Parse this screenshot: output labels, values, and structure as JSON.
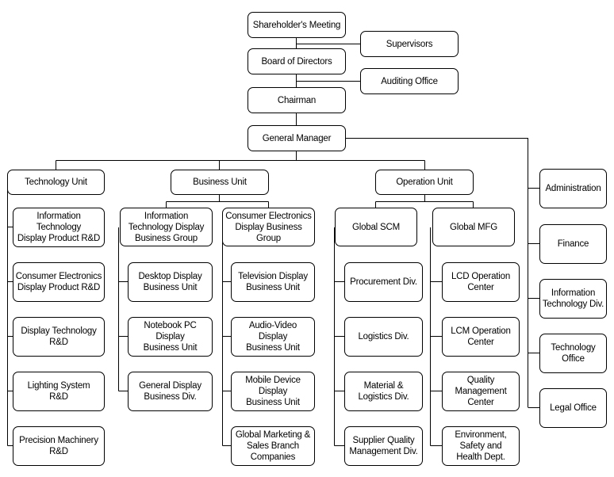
{
  "chart": {
    "shareholders": "Shareholder's Meeting",
    "supervisors": "Supervisors",
    "board": "Board of Directors",
    "auditing": "Auditing Office",
    "chairman": "Chairman",
    "gm": "General Manager",
    "technology_unit": {
      "label": "Technology Unit",
      "children": [
        "Information\nTechnology\nDisplay Product R&D",
        "Consumer Electronics\nDisplay Product R&D",
        "Display Technology\nR&D",
        "Lighting System\nR&D",
        "Precision Machinery\nR&D"
      ]
    },
    "business_unit": {
      "label": "Business Unit",
      "groups": [
        {
          "label": "Information\nTechnology Display\nBusiness Group",
          "children": [
            "Desktop Display\nBusiness Unit",
            "Notebook PC\nDisplay\nBusiness Unit",
            "General Display\nBusiness Div."
          ]
        },
        {
          "label": "Consumer Electronics\nDisplay Business\nGroup",
          "children": [
            "Television Display\nBusiness Unit",
            "Audio-Video\nDisplay\nBusiness Unit",
            "Mobile Device\nDisplay\nBusiness Unit",
            "Global Marketing &\nSales Branch\nCompanies"
          ]
        }
      ]
    },
    "operation_unit": {
      "label": "Operation Unit",
      "groups": [
        {
          "label": "Global SCM",
          "children": [
            "Procurement Div.",
            "Logistics Div.",
            "Material &\nLogistics Div.",
            "Supplier Quality\nManagement Div."
          ]
        },
        {
          "label": "Global MFG",
          "children": [
            "LCD Operation\nCenter",
            "LCM Operation\nCenter",
            "Quality\nManagement\nCenter",
            "Environment,\nSafety and\nHealth Dept."
          ]
        }
      ]
    },
    "staff_offices": [
      "Administration",
      "Finance",
      "Information\nTechnology Div.",
      "Technology\nOffice",
      "Legal Office"
    ]
  }
}
